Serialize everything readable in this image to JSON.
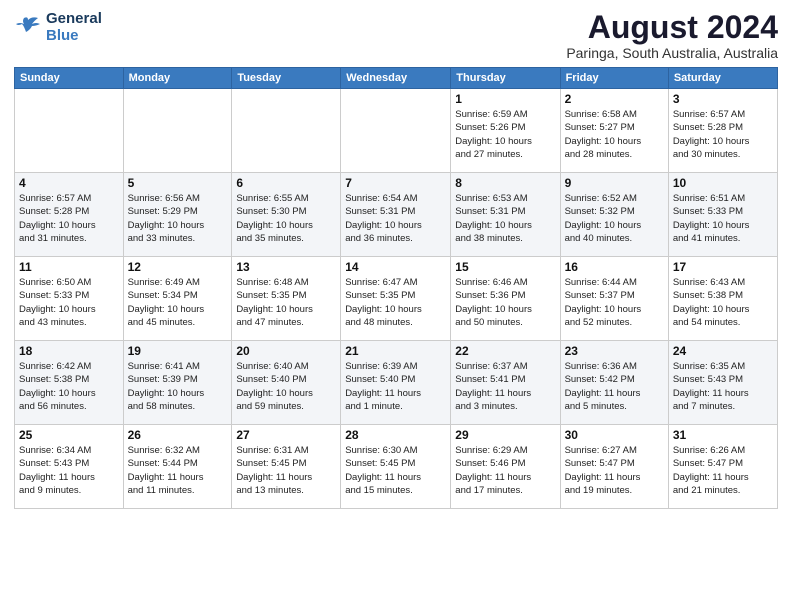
{
  "logo": {
    "line1": "General",
    "line2": "Blue"
  },
  "calendar": {
    "title": "August 2024",
    "subtitle": "Paringa, South Australia, Australia",
    "days_of_week": [
      "Sunday",
      "Monday",
      "Tuesday",
      "Wednesday",
      "Thursday",
      "Friday",
      "Saturday"
    ],
    "weeks": [
      [
        {
          "day": "",
          "info": ""
        },
        {
          "day": "",
          "info": ""
        },
        {
          "day": "",
          "info": ""
        },
        {
          "day": "",
          "info": ""
        },
        {
          "day": "1",
          "info": "Sunrise: 6:59 AM\nSunset: 5:26 PM\nDaylight: 10 hours\nand 27 minutes."
        },
        {
          "day": "2",
          "info": "Sunrise: 6:58 AM\nSunset: 5:27 PM\nDaylight: 10 hours\nand 28 minutes."
        },
        {
          "day": "3",
          "info": "Sunrise: 6:57 AM\nSunset: 5:28 PM\nDaylight: 10 hours\nand 30 minutes."
        }
      ],
      [
        {
          "day": "4",
          "info": "Sunrise: 6:57 AM\nSunset: 5:28 PM\nDaylight: 10 hours\nand 31 minutes."
        },
        {
          "day": "5",
          "info": "Sunrise: 6:56 AM\nSunset: 5:29 PM\nDaylight: 10 hours\nand 33 minutes."
        },
        {
          "day": "6",
          "info": "Sunrise: 6:55 AM\nSunset: 5:30 PM\nDaylight: 10 hours\nand 35 minutes."
        },
        {
          "day": "7",
          "info": "Sunrise: 6:54 AM\nSunset: 5:31 PM\nDaylight: 10 hours\nand 36 minutes."
        },
        {
          "day": "8",
          "info": "Sunrise: 6:53 AM\nSunset: 5:31 PM\nDaylight: 10 hours\nand 38 minutes."
        },
        {
          "day": "9",
          "info": "Sunrise: 6:52 AM\nSunset: 5:32 PM\nDaylight: 10 hours\nand 40 minutes."
        },
        {
          "day": "10",
          "info": "Sunrise: 6:51 AM\nSunset: 5:33 PM\nDaylight: 10 hours\nand 41 minutes."
        }
      ],
      [
        {
          "day": "11",
          "info": "Sunrise: 6:50 AM\nSunset: 5:33 PM\nDaylight: 10 hours\nand 43 minutes."
        },
        {
          "day": "12",
          "info": "Sunrise: 6:49 AM\nSunset: 5:34 PM\nDaylight: 10 hours\nand 45 minutes."
        },
        {
          "day": "13",
          "info": "Sunrise: 6:48 AM\nSunset: 5:35 PM\nDaylight: 10 hours\nand 47 minutes."
        },
        {
          "day": "14",
          "info": "Sunrise: 6:47 AM\nSunset: 5:35 PM\nDaylight: 10 hours\nand 48 minutes."
        },
        {
          "day": "15",
          "info": "Sunrise: 6:46 AM\nSunset: 5:36 PM\nDaylight: 10 hours\nand 50 minutes."
        },
        {
          "day": "16",
          "info": "Sunrise: 6:44 AM\nSunset: 5:37 PM\nDaylight: 10 hours\nand 52 minutes."
        },
        {
          "day": "17",
          "info": "Sunrise: 6:43 AM\nSunset: 5:38 PM\nDaylight: 10 hours\nand 54 minutes."
        }
      ],
      [
        {
          "day": "18",
          "info": "Sunrise: 6:42 AM\nSunset: 5:38 PM\nDaylight: 10 hours\nand 56 minutes."
        },
        {
          "day": "19",
          "info": "Sunrise: 6:41 AM\nSunset: 5:39 PM\nDaylight: 10 hours\nand 58 minutes."
        },
        {
          "day": "20",
          "info": "Sunrise: 6:40 AM\nSunset: 5:40 PM\nDaylight: 10 hours\nand 59 minutes."
        },
        {
          "day": "21",
          "info": "Sunrise: 6:39 AM\nSunset: 5:40 PM\nDaylight: 11 hours\nand 1 minute."
        },
        {
          "day": "22",
          "info": "Sunrise: 6:37 AM\nSunset: 5:41 PM\nDaylight: 11 hours\nand 3 minutes."
        },
        {
          "day": "23",
          "info": "Sunrise: 6:36 AM\nSunset: 5:42 PM\nDaylight: 11 hours\nand 5 minutes."
        },
        {
          "day": "24",
          "info": "Sunrise: 6:35 AM\nSunset: 5:43 PM\nDaylight: 11 hours\nand 7 minutes."
        }
      ],
      [
        {
          "day": "25",
          "info": "Sunrise: 6:34 AM\nSunset: 5:43 PM\nDaylight: 11 hours\nand 9 minutes."
        },
        {
          "day": "26",
          "info": "Sunrise: 6:32 AM\nSunset: 5:44 PM\nDaylight: 11 hours\nand 11 minutes."
        },
        {
          "day": "27",
          "info": "Sunrise: 6:31 AM\nSunset: 5:45 PM\nDaylight: 11 hours\nand 13 minutes."
        },
        {
          "day": "28",
          "info": "Sunrise: 6:30 AM\nSunset: 5:45 PM\nDaylight: 11 hours\nand 15 minutes."
        },
        {
          "day": "29",
          "info": "Sunrise: 6:29 AM\nSunset: 5:46 PM\nDaylight: 11 hours\nand 17 minutes."
        },
        {
          "day": "30",
          "info": "Sunrise: 6:27 AM\nSunset: 5:47 PM\nDaylight: 11 hours\nand 19 minutes."
        },
        {
          "day": "31",
          "info": "Sunrise: 6:26 AM\nSunset: 5:47 PM\nDaylight: 11 hours\nand 21 minutes."
        }
      ]
    ]
  }
}
